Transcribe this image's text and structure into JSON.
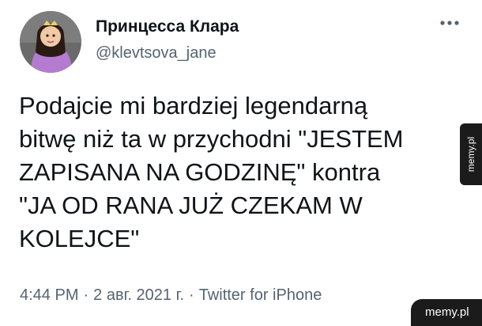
{
  "tweet": {
    "author": {
      "display_name": "Принцесса Клара",
      "handle": "@klevtsova_jane"
    },
    "text_lines": [
      "Podajcie mi bardziej legendarną",
      "bitwę niż ta w przychodni \"JESTEM",
      "ZAPISANA NA GODZINĘ\" kontra",
      "\"JA OD RANA JUŻ CZEKAM W",
      "KOLEJCE\""
    ],
    "time": "4:44 PM",
    "date": "2 авг. 2021 г.",
    "source": "Twitter for iPhone",
    "separator": "·"
  },
  "watermarks": {
    "side": "memy.pl",
    "corner": "memy.pl"
  },
  "icons": {
    "avatar": "avatar-image",
    "more": "more-options-icon"
  },
  "colors": {
    "text_primary": "#0f1419",
    "text_secondary": "#536471",
    "watermark_bg": "#1b1b1b"
  }
}
